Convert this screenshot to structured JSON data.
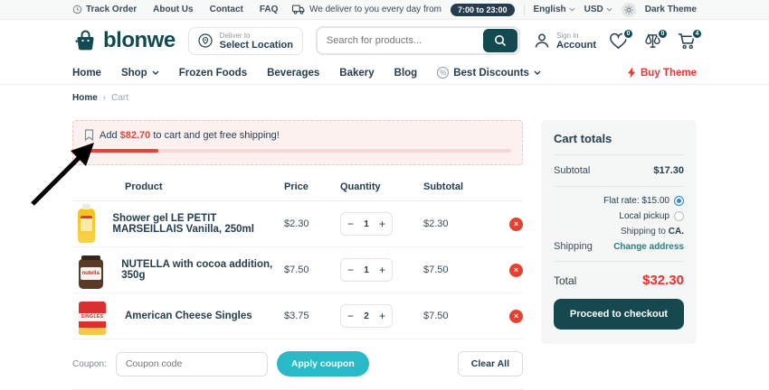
{
  "topbar": {
    "links": {
      "track_order": "Track Order",
      "about": "About Us",
      "contact": "Contact",
      "faq": "FAQ"
    },
    "delivery_text": "We deliver to you every day from",
    "delivery_hours": "7:00 to 23:00",
    "language": "English",
    "currency": "USD",
    "theme_label": "Dark Theme"
  },
  "header": {
    "brand": "blonwe",
    "deliver_to_label": "Deliver to",
    "location_label": "Select Location",
    "search_placeholder": "Search for products...",
    "sign_in": "Sign in",
    "account": "Account",
    "wishlist_count": "0",
    "compare_count": "0",
    "cart_count": "4"
  },
  "nav": {
    "items": [
      "Home",
      "Shop",
      "Frozen Foods",
      "Beverages",
      "Bakery",
      "Blog",
      "Best Discounts"
    ],
    "buy_theme": "Buy Theme"
  },
  "breadcrumb": {
    "home": "Home",
    "sep": "›",
    "current": "Cart"
  },
  "banner": {
    "prefix": "Add",
    "amount": "$82.70",
    "suffix": "to cart and get free shipping!",
    "progress_percent": 17.3
  },
  "cart": {
    "headers": {
      "product": "Product",
      "price": "Price",
      "quantity": "Quantity",
      "subtotal": "Subtotal"
    },
    "items": [
      {
        "name": "Shower gel LE PETIT MARSEILLAIS Vanilla, 250ml",
        "price": "$2.30",
        "qty": "1",
        "subtotal": "$2.30"
      },
      {
        "name": "NUTELLA with cocoa addition, 350g",
        "price": "$7.50",
        "qty": "1",
        "subtotal": "$7.50"
      },
      {
        "name": "American Cheese Singles",
        "price": "$3.75",
        "qty": "2",
        "subtotal": "$7.50"
      }
    ],
    "coupon_label": "Coupon:",
    "coupon_placeholder": "Coupon code",
    "apply_coupon": "Apply coupon",
    "clear_all": "Clear All"
  },
  "totals": {
    "title": "Cart totals",
    "subtotal_label": "Subtotal",
    "subtotal_value": "$17.30",
    "shipping_label": "Shipping",
    "flat_rate": "Flat rate: $15.00",
    "local_pickup": "Local pickup",
    "shipping_to_prefix": "Shipping to",
    "shipping_to_state": "CA.",
    "change_address": "Change address",
    "total_label": "Total",
    "total_value": "$32.30",
    "checkout": "Proceed to checkout"
  },
  "glyphs": {
    "minus": "−",
    "plus": "+",
    "close": "×"
  },
  "colors": {
    "brand_dark_teal": "#134950",
    "accent_red": "#ef2d2d",
    "progress_red": "#e8443a",
    "apply_teal": "#29b9c7",
    "radio_blue": "#2f86eb",
    "topbar_badge": "#253d4e"
  }
}
